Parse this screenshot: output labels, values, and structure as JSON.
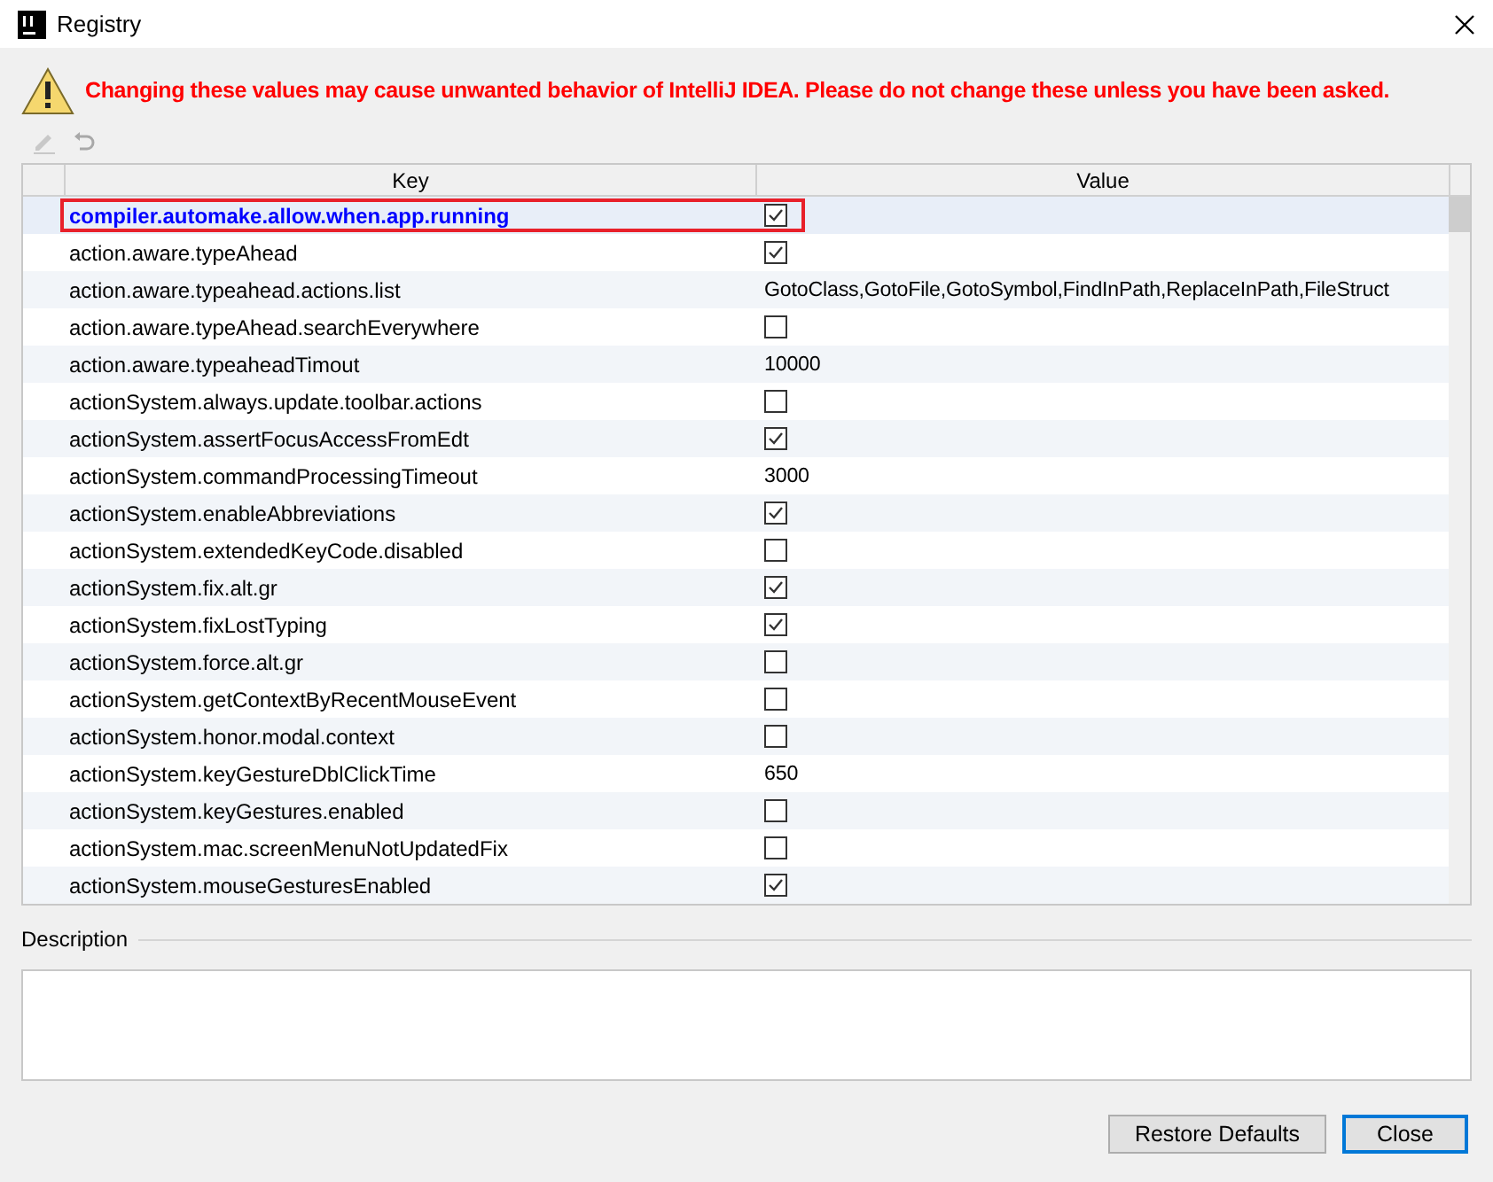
{
  "window": {
    "title": "Registry"
  },
  "warning": "Changing these values may cause unwanted behavior of IntelliJ IDEA. Please do not change these unless you have been asked.",
  "table": {
    "columns": [
      "Key",
      "Value"
    ],
    "rows": [
      {
        "key": "compiler.automake.allow.when.app.running",
        "kind": "checkbox",
        "checked": true,
        "selected": true
      },
      {
        "key": "action.aware.typeAhead",
        "kind": "checkbox",
        "checked": true,
        "selected": false
      },
      {
        "key": "action.aware.typeahead.actions.list",
        "kind": "text",
        "value": "GotoClass,GotoFile,GotoSymbol,FindInPath,ReplaceInPath,FileStruct",
        "selected": false
      },
      {
        "key": "action.aware.typeAhead.searchEverywhere",
        "kind": "checkbox",
        "checked": false,
        "selected": false
      },
      {
        "key": "action.aware.typeaheadTimout",
        "kind": "text",
        "value": "10000",
        "selected": false
      },
      {
        "key": "actionSystem.always.update.toolbar.actions",
        "kind": "checkbox",
        "checked": false,
        "selected": false
      },
      {
        "key": "actionSystem.assertFocusAccessFromEdt",
        "kind": "checkbox",
        "checked": true,
        "selected": false
      },
      {
        "key": "actionSystem.commandProcessingTimeout",
        "kind": "text",
        "value": "3000",
        "selected": false
      },
      {
        "key": "actionSystem.enableAbbreviations",
        "kind": "checkbox",
        "checked": true,
        "selected": false
      },
      {
        "key": "actionSystem.extendedKeyCode.disabled",
        "kind": "checkbox",
        "checked": false,
        "selected": false
      },
      {
        "key": "actionSystem.fix.alt.gr",
        "kind": "checkbox",
        "checked": true,
        "selected": false
      },
      {
        "key": "actionSystem.fixLostTyping",
        "kind": "checkbox",
        "checked": true,
        "selected": false
      },
      {
        "key": "actionSystem.force.alt.gr",
        "kind": "checkbox",
        "checked": false,
        "selected": false
      },
      {
        "key": "actionSystem.getContextByRecentMouseEvent",
        "kind": "checkbox",
        "checked": false,
        "selected": false
      },
      {
        "key": "actionSystem.honor.modal.context",
        "kind": "checkbox",
        "checked": false,
        "selected": false
      },
      {
        "key": "actionSystem.keyGestureDblClickTime",
        "kind": "text",
        "value": "650",
        "selected": false
      },
      {
        "key": "actionSystem.keyGestures.enabled",
        "kind": "checkbox",
        "checked": false,
        "selected": false
      },
      {
        "key": "actionSystem.mac.screenMenuNotUpdatedFix",
        "kind": "checkbox",
        "checked": false,
        "selected": false
      },
      {
        "key": "actionSystem.mouseGesturesEnabled",
        "kind": "checkbox",
        "checked": true,
        "selected": false
      }
    ]
  },
  "description": {
    "label": "Description"
  },
  "buttons": [
    {
      "label": "Restore Defaults",
      "kind": "normal"
    },
    {
      "label": "Close",
      "kind": "default"
    }
  ]
}
